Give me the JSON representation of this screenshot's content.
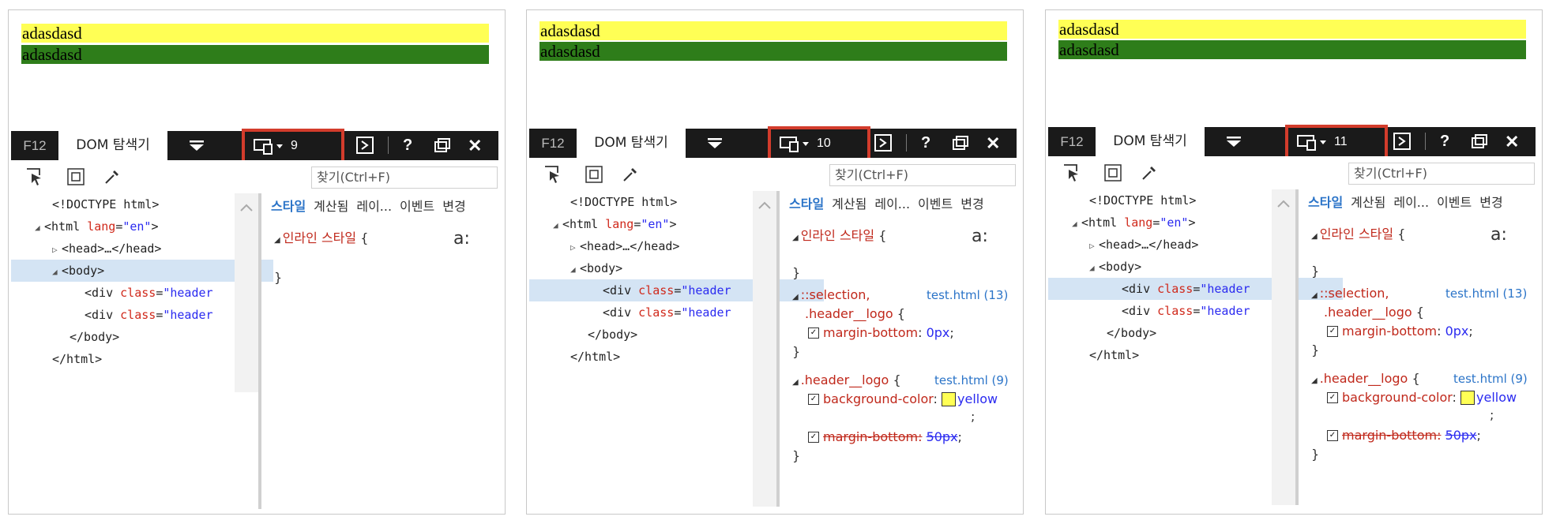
{
  "page": {
    "lines": [
      "adasdasd",
      "adasdasd"
    ]
  },
  "devtools": {
    "f12": "F12",
    "dom_tab": "DOM 탐색기",
    "find_placeholder": "찾기(Ctrl+F)",
    "help": "?",
    "close": "✕"
  },
  "dom": {
    "doctype": "<!DOCTYPE html>",
    "html_open": "<html",
    "lang_attr": "lang",
    "lang_eq": "=",
    "lang_val": "\"en\"",
    "gt": ">",
    "head": "<head>…</head>",
    "body_open": "<body>",
    "div_open": "<div",
    "class_attr": "class",
    "class_eq": "=",
    "class_val": "\"header",
    "body_close": "</body>",
    "html_close": "</html>"
  },
  "styles_tabs": [
    "스타일",
    "계산됨",
    "레이...",
    "이벤트",
    "변경"
  ],
  "styles": {
    "inline": "인라인 스타일",
    "open_brace": "{",
    "close_brace": "}",
    "a_glyph": "a:",
    "rule1_selector_line1": "::selection,",
    "rule1_selector_line2": ".header__logo",
    "rule1_source": "test.html (13)",
    "rule1_prop": "margin-bottom",
    "rule1_val": "0px",
    "rule2_selector": ".header__logo",
    "rule2_source": "test.html (9)",
    "rule2_prop1": "background-color",
    "rule2_val1": "yellow",
    "rule2_prop2": "margin-bottom",
    "rule2_val2": "50px",
    "colon": ":",
    "semicolon": ";"
  },
  "panels": [
    {
      "doc_mode": "9"
    },
    {
      "doc_mode": "10"
    },
    {
      "doc_mode": "11"
    }
  ],
  "colors": {
    "highlight": "#d33c2c",
    "yellow_bar": "#ffff55",
    "green_bar": "#2e7d1a",
    "toolbar": "#1a1a1a"
  }
}
